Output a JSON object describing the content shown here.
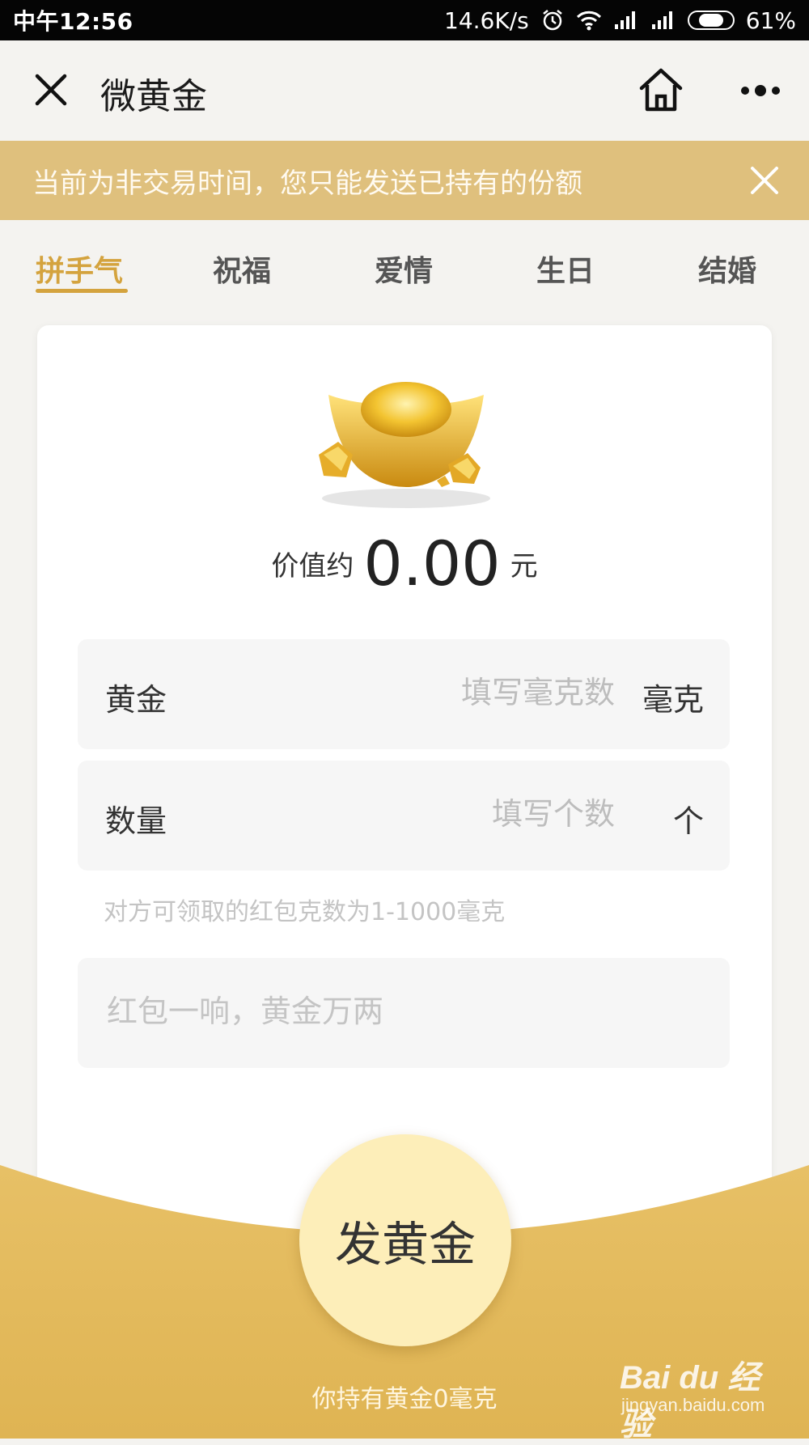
{
  "status_bar": {
    "carrier_time": "中午12:56",
    "net_speed": "14.6K/s",
    "battery_percent": "61%",
    "icons": [
      "alarm-icon",
      "wifi-icon",
      "signal-icon",
      "signal-icon",
      "battery-icon"
    ]
  },
  "header": {
    "title": "微黄金",
    "close_icon": "close-icon",
    "home_icon": "home-icon",
    "more_icon": "more-icon"
  },
  "notice": {
    "text": "当前为非交易时间，您只能发送已持有的份额",
    "close_icon": "close-icon"
  },
  "tabs": [
    {
      "label": "拼手气",
      "active": true
    },
    {
      "label": "祝福",
      "active": false
    },
    {
      "label": "爱情",
      "active": false
    },
    {
      "label": "生日",
      "active": false
    },
    {
      "label": "结婚",
      "active": false
    }
  ],
  "card": {
    "image": "gold-ingot-icon",
    "value_label": "价值约",
    "value_amount": "0.00",
    "value_unit": "元",
    "gold_field": {
      "label": "黄金",
      "placeholder": "填写毫克数",
      "value": "",
      "unit": "毫克"
    },
    "count_field": {
      "label": "数量",
      "placeholder": "填写个数",
      "value": "",
      "unit": "个"
    },
    "hint": "对方可领取的红包克数为1-1000毫克",
    "message_placeholder": "红包一响，黄金万两"
  },
  "send_button": "发黄金",
  "holding_text": "你持有黄金0毫克",
  "watermark": {
    "main": "Bai du 经验",
    "url": "jingyan.baidu.com"
  },
  "colors": {
    "accent": "#d4a33e",
    "banner": "#dfc07d",
    "bottom_gold": "#e2bb5c",
    "button": "#fdeeb9"
  }
}
